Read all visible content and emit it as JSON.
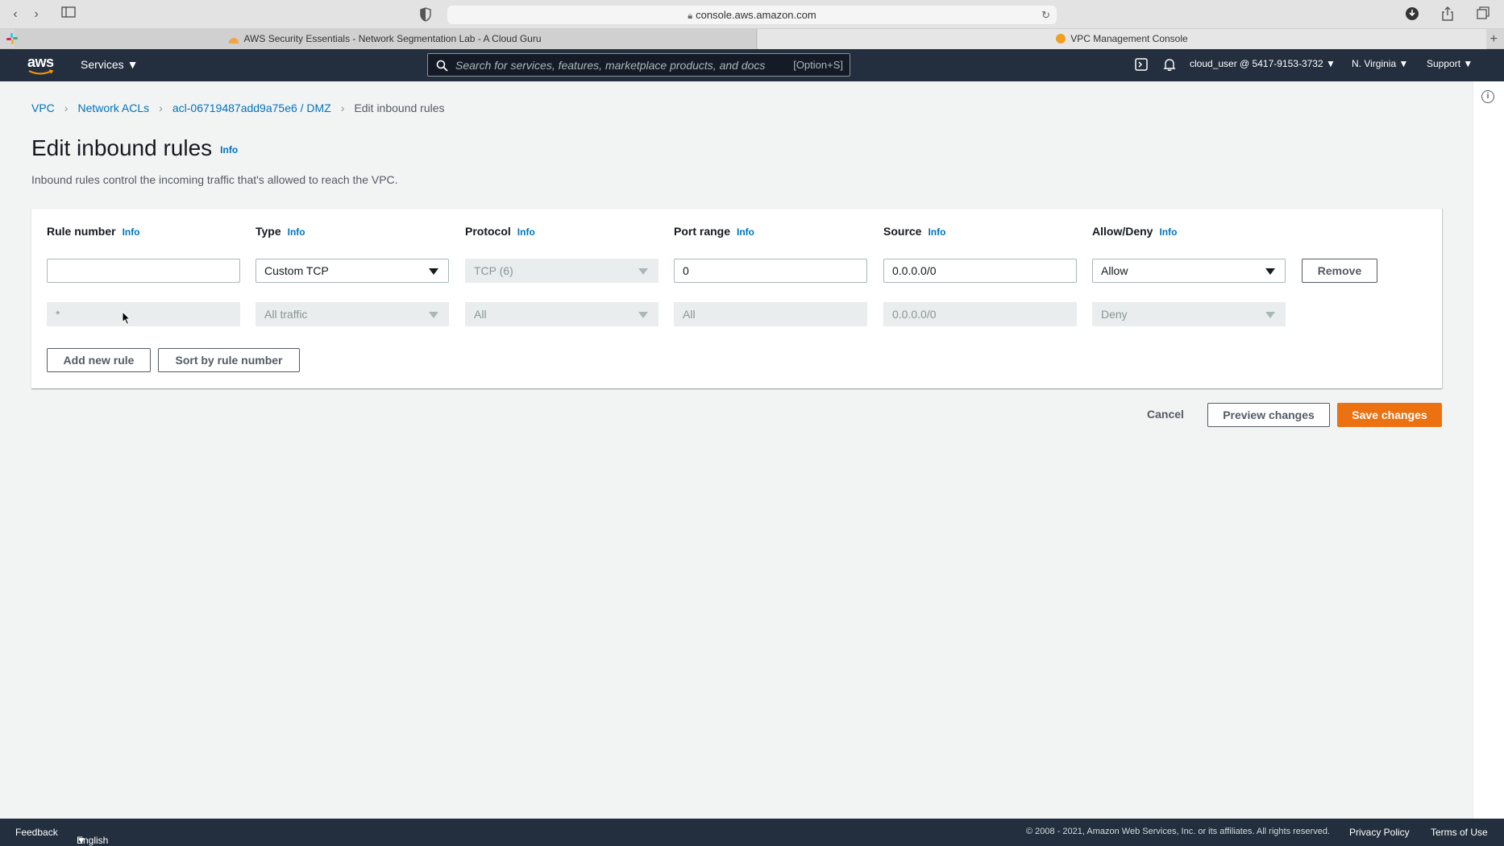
{
  "browser": {
    "url": "console.aws.amazon.com",
    "tabs": [
      {
        "label": "AWS Security Essentials - Network Segmentation Lab - A Cloud Guru"
      },
      {
        "label": "VPC Management Console"
      }
    ]
  },
  "nav": {
    "logo": "aws",
    "services_label": "Services",
    "search_placeholder": "Search for services, features, marketplace products, and docs",
    "search_shortcut": "[Option+S]",
    "account": "cloud_user @ 5417-9153-3732",
    "region": "N. Virginia",
    "support": "Support"
  },
  "breadcrumb": {
    "items": [
      "VPC",
      "Network ACLs",
      "acl-06719487add9a75e6 / DMZ"
    ],
    "current": "Edit inbound rules"
  },
  "page": {
    "title": "Edit inbound rules",
    "info": "Info",
    "description": "Inbound rules control the incoming traffic that's allowed to reach the VPC."
  },
  "table": {
    "headers": {
      "rule_number": "Rule number",
      "type": "Type",
      "protocol": "Protocol",
      "port_range": "Port range",
      "source": "Source",
      "allow_deny": "Allow/Deny"
    },
    "info": "Info",
    "rows": [
      {
        "rule_number": "",
        "type": "Custom TCP",
        "protocol": "TCP (6)",
        "port_range": "0",
        "source": "0.0.0.0/0",
        "allow_deny": "Allow",
        "remove": "Remove"
      },
      {
        "rule_number": "*",
        "type": "All traffic",
        "protocol": "All",
        "port_range": "All",
        "source": "0.0.0.0/0",
        "allow_deny": "Deny"
      }
    ],
    "add_rule": "Add new rule",
    "sort_rule": "Sort by rule number"
  },
  "actions": {
    "cancel": "Cancel",
    "preview": "Preview changes",
    "save": "Save changes"
  },
  "footer": {
    "feedback": "Feedback",
    "language": "English (US)",
    "copyright": "© 2008 - 2021, Amazon Web Services, Inc. or its affiliates. All rights reserved.",
    "privacy": "Privacy Policy",
    "terms": "Terms of Use"
  },
  "colors": {
    "nav_bg": "#232f3e",
    "link": "#0073bb",
    "primary": "#ec7211"
  }
}
